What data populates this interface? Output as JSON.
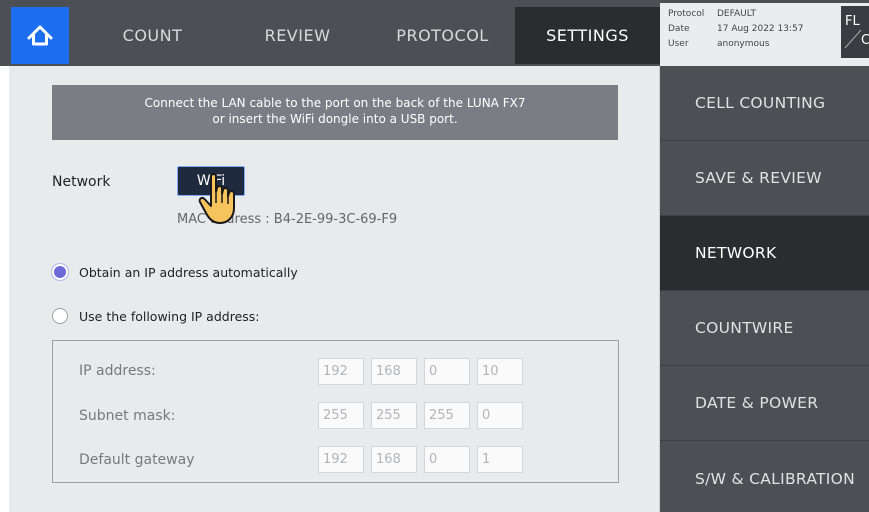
{
  "header": {
    "tabs": [
      {
        "label": "COUNT"
      },
      {
        "label": "REVIEW"
      },
      {
        "label": "PROTOCOL"
      },
      {
        "label": "SETTINGS",
        "active": true
      }
    ],
    "info": {
      "protocol_key": "Protocol",
      "protocol_value": "DEFAULT",
      "date_key": "Date",
      "date_value": "17 Aug 2022 13:57",
      "user_key": "User",
      "user_value": "anonymous"
    },
    "mode_label_top": "FL",
    "mode_label_bottom": "C"
  },
  "network_page": {
    "notice_line1": "Connect the LAN cable to the port on the back of the LUNA FX7",
    "notice_line2": "or insert the WiFi dongle into a USB port.",
    "network_label": "Network",
    "wifi_button": "WiFi",
    "mac_address": "MAC address : B4-2E-99-3C-69-F9",
    "radio_auto": "Obtain an IP address automatically",
    "radio_manual": "Use the following IP address:",
    "selected_option": "auto",
    "fields": [
      {
        "label": "IP address:",
        "octets": [
          "192",
          "168",
          "0",
          "10"
        ]
      },
      {
        "label": "Subnet mask:",
        "octets": [
          "255",
          "255",
          "255",
          "0"
        ]
      },
      {
        "label": "Default gateway",
        "octets": [
          "192",
          "168",
          "0",
          "1"
        ]
      }
    ]
  },
  "sidebar": {
    "items": [
      {
        "label": "CELL COUNTING"
      },
      {
        "label": "SAVE & REVIEW"
      },
      {
        "label": "NETWORK",
        "active": true
      },
      {
        "label": "COUNTWIRE"
      },
      {
        "label": "DATE & POWER"
      },
      {
        "label": "S/W & CALIBRATION"
      }
    ]
  },
  "icons": {
    "home": "home-icon",
    "cursor": "hand-pointer-icon"
  },
  "colors": {
    "accent": "#1e6ff0",
    "radio_selected": "#6f68d8",
    "dark_active": "#2b2c30"
  }
}
